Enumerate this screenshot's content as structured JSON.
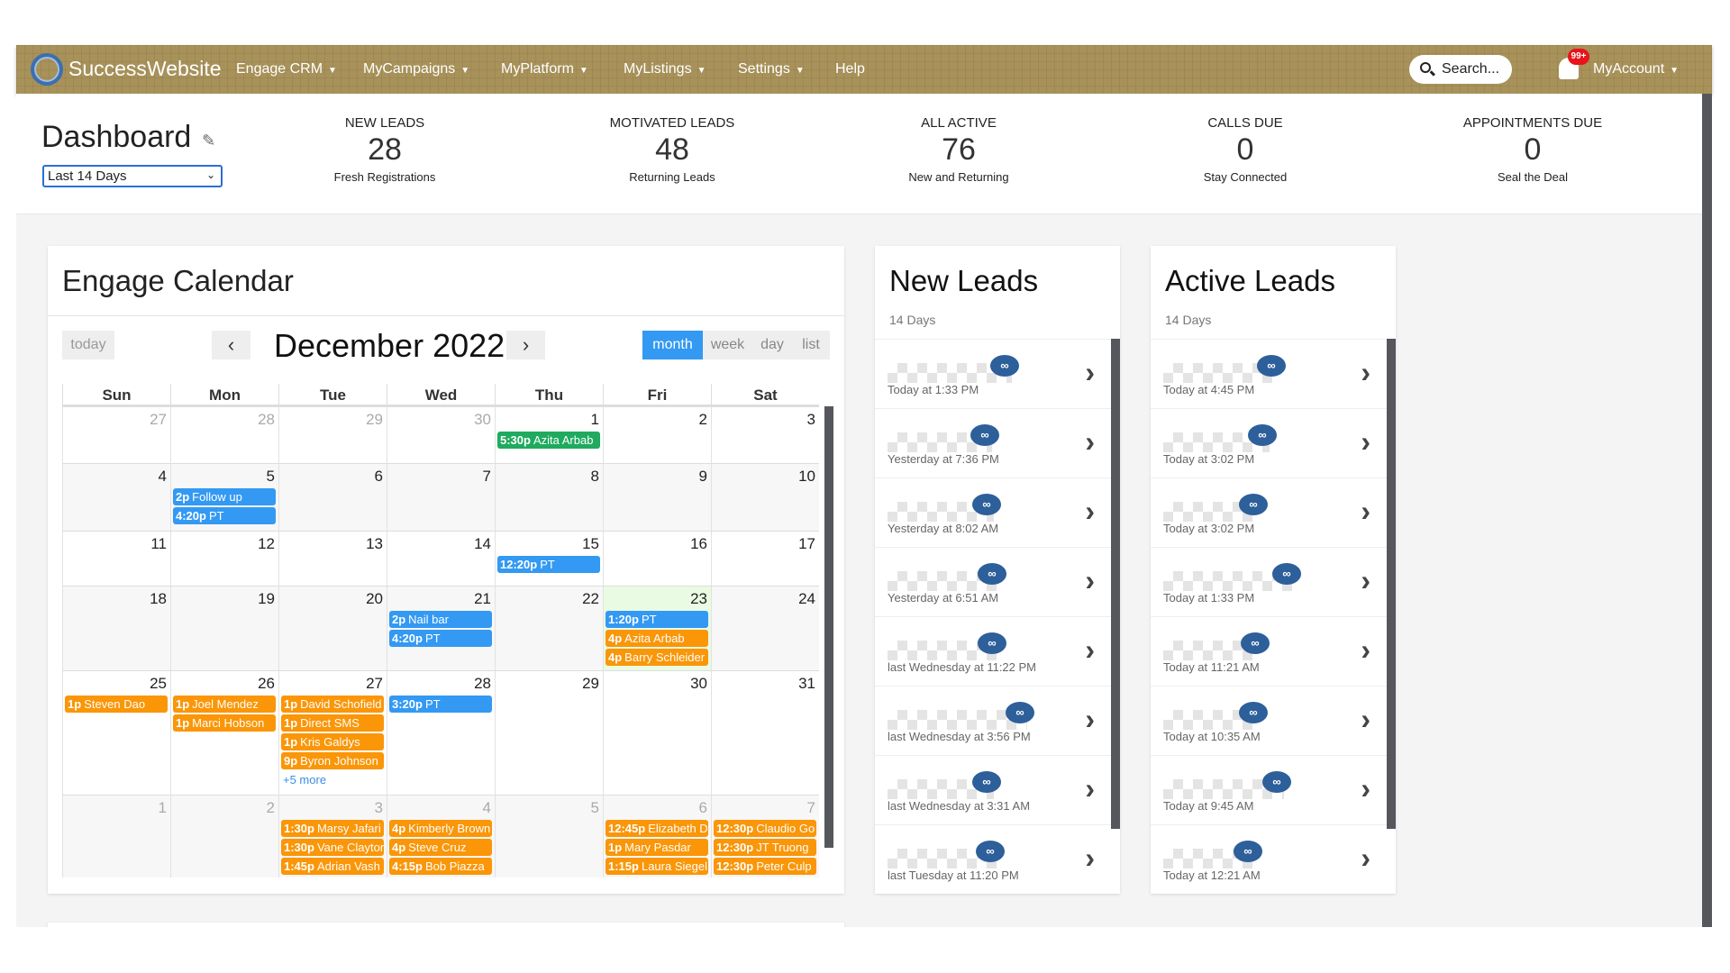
{
  "nav": {
    "brand": "SuccessWebsite",
    "items": [
      "Engage CRM",
      "MyCampaigns",
      "MyPlatform",
      "MyListings",
      "Settings",
      "Help"
    ],
    "search_placeholder": "Search...",
    "notif_badge": "99+",
    "account": "MyAccount",
    "color": "#a8925a"
  },
  "header": {
    "title": "Dashboard",
    "range": "Last 14 Days",
    "stats": [
      {
        "label": "NEW LEADS",
        "value": "28",
        "sub": "Fresh Registrations"
      },
      {
        "label": "MOTIVATED LEADS",
        "value": "48",
        "sub": "Returning Leads"
      },
      {
        "label": "ALL ACTIVE",
        "value": "76",
        "sub": "New and Returning"
      },
      {
        "label": "CALLS DUE",
        "value": "0",
        "sub": "Stay Connected"
      },
      {
        "label": "APPOINTMENTS DUE",
        "value": "0",
        "sub": "Seal the Deal"
      }
    ]
  },
  "calendar": {
    "title": "Engage Calendar",
    "today": "today",
    "month_title": "December 2022",
    "prev": "‹",
    "next": "›",
    "views": [
      "month",
      "week",
      "day",
      "list"
    ],
    "active_view": "month",
    "days": [
      "Sun",
      "Mon",
      "Tue",
      "Wed",
      "Thu",
      "Fri",
      "Sat"
    ],
    "colors": {
      "blue": "#3399f3",
      "green": "#1faa5f",
      "orange": "#fa9608",
      "today_bg": "#e9fbe2"
    },
    "weeks": [
      [
        {
          "n": "27",
          "o": true
        },
        {
          "n": "28",
          "o": true
        },
        {
          "n": "29",
          "o": true
        },
        {
          "n": "30",
          "o": true
        },
        {
          "n": "1",
          "ev": [
            {
              "t": "5:30p",
              "x": "Azita Arbab",
              "c": "green"
            }
          ]
        },
        {
          "n": "2"
        },
        {
          "n": "3"
        }
      ],
      [
        {
          "n": "4"
        },
        {
          "n": "5",
          "ev": [
            {
              "t": "2p",
              "x": "Follow up",
              "c": "blue"
            },
            {
              "t": "4:20p",
              "x": "PT",
              "c": "blue"
            }
          ]
        },
        {
          "n": "6"
        },
        {
          "n": "7"
        },
        {
          "n": "8"
        },
        {
          "n": "9"
        },
        {
          "n": "10"
        }
      ],
      [
        {
          "n": "11"
        },
        {
          "n": "12"
        },
        {
          "n": "13"
        },
        {
          "n": "14"
        },
        {
          "n": "15",
          "ev": [
            {
              "t": "12:20p",
              "x": "PT",
              "c": "blue"
            }
          ]
        },
        {
          "n": "16"
        },
        {
          "n": "17"
        }
      ],
      [
        {
          "n": "18"
        },
        {
          "n": "19"
        },
        {
          "n": "20"
        },
        {
          "n": "21",
          "ev": [
            {
              "t": "2p",
              "x": "Nail bar",
              "c": "blue"
            },
            {
              "t": "4:20p",
              "x": "PT",
              "c": "blue"
            }
          ]
        },
        {
          "n": "22"
        },
        {
          "n": "23",
          "today": true,
          "ev": [
            {
              "t": "1:20p",
              "x": "PT",
              "c": "blue"
            },
            {
              "t": "4p",
              "x": "Azita Arbab",
              "c": "orange"
            },
            {
              "t": "4p",
              "x": "Barry Schleider",
              "c": "orange"
            }
          ]
        },
        {
          "n": "24"
        }
      ],
      [
        {
          "n": "25",
          "ev": [
            {
              "t": "1p",
              "x": "Steven Dao",
              "c": "orange"
            }
          ]
        },
        {
          "n": "26",
          "ev": [
            {
              "t": "1p",
              "x": "Joel Mendez",
              "c": "orange"
            },
            {
              "t": "1p",
              "x": "Marci Hobson",
              "c": "orange"
            }
          ]
        },
        {
          "n": "27",
          "ev": [
            {
              "t": "1p",
              "x": "David Schofield",
              "c": "orange"
            },
            {
              "t": "1p",
              "x": "Direct SMS",
              "c": "orange"
            },
            {
              "t": "1p",
              "x": "Kris Galdys",
              "c": "orange"
            },
            {
              "t": "9p",
              "x": "Byron Johnson",
              "c": "orange"
            }
          ],
          "more": "+5 more"
        },
        {
          "n": "28",
          "ev": [
            {
              "t": "3:20p",
              "x": "PT",
              "c": "blue"
            }
          ]
        },
        {
          "n": "29"
        },
        {
          "n": "30"
        },
        {
          "n": "31"
        }
      ],
      [
        {
          "n": "1",
          "o": true
        },
        {
          "n": "2",
          "o": true
        },
        {
          "n": "3",
          "o": true,
          "ev": [
            {
              "t": "1:30p",
              "x": "Marsy Jafari",
              "c": "orange"
            },
            {
              "t": "1:30p",
              "x": "Vane Clayton",
              "c": "orange"
            },
            {
              "t": "1:45p",
              "x": "Adrian Vash",
              "c": "orange"
            }
          ]
        },
        {
          "n": "4",
          "o": true,
          "ev": [
            {
              "t": "4p",
              "x": "Kimberly Brown",
              "c": "orange"
            },
            {
              "t": "4p",
              "x": "Steve Cruz",
              "c": "orange"
            },
            {
              "t": "4:15p",
              "x": "Bob Piazza",
              "c": "orange"
            }
          ]
        },
        {
          "n": "5",
          "o": true
        },
        {
          "n": "6",
          "o": true,
          "ev": [
            {
              "t": "12:45p",
              "x": "Elizabeth D",
              "c": "orange"
            },
            {
              "t": "1p",
              "x": "Mary Pasdar",
              "c": "orange"
            },
            {
              "t": "1:15p",
              "x": "Laura Siegel",
              "c": "orange"
            }
          ]
        },
        {
          "n": "7",
          "o": true,
          "ev": [
            {
              "t": "12:30p",
              "x": "Claudio Go",
              "c": "orange"
            },
            {
              "t": "12:30p",
              "x": "JT Truong",
              "c": "orange"
            },
            {
              "t": "12:30p",
              "x": "Peter Culp",
              "c": "orange"
            }
          ]
        }
      ]
    ]
  },
  "new_leads": {
    "title": "New Leads",
    "sub": "14 Days",
    "items": [
      "Today at 1:33 PM",
      "Yesterday at 7:36 PM",
      "Yesterday at 8:02 AM",
      "Yesterday at 6:51 AM",
      "last Wednesday at 11:22 PM",
      "last Wednesday at 3:56 PM",
      "last Wednesday at 3:31 AM",
      "last Tuesday at 11:20 PM"
    ]
  },
  "active_leads": {
    "title": "Active Leads",
    "sub": "14 Days",
    "items": [
      "Today at 4:45 PM",
      "Today at 3:02 PM",
      "Today at 3:02 PM",
      "Today at 1:33 PM",
      "Today at 11:21 AM",
      "Today at 10:35 AM",
      "Today at 9:45 AM",
      "Today at 12:21 AM"
    ]
  }
}
